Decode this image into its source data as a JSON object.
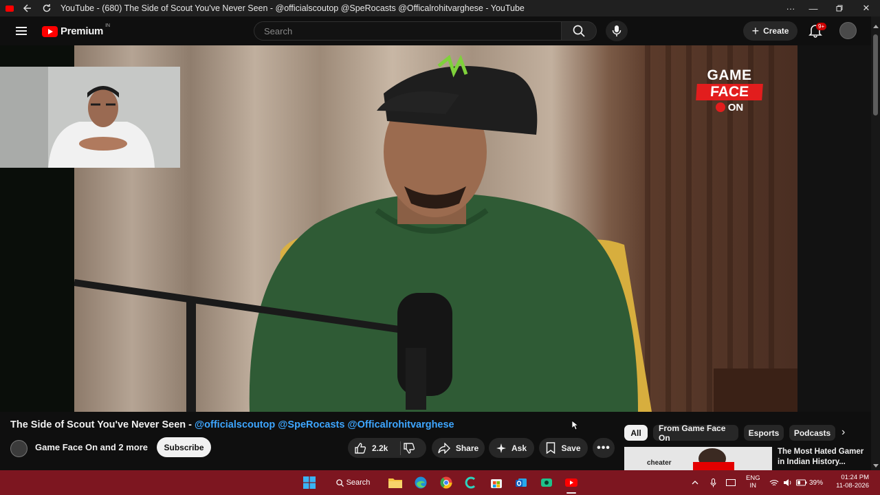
{
  "window": {
    "title": "YouTube - (680) The Side of Scout You've Never Seen - @officialscoutop @SpeRocasts @Officalrohitvarghese - YouTube"
  },
  "masthead": {
    "logo_text": "Premium",
    "country_code": "IN",
    "search_placeholder": "Search",
    "create_label": "Create",
    "notification_count": "9+"
  },
  "video": {
    "overlay_line1": "GAME",
    "overlay_line2": "FACE",
    "overlay_line3": "ON"
  },
  "details": {
    "title_prefix": "The Side of Scout You've Never Seen - ",
    "title_mentions": "@officialscoutop @SpeRocasts @Officalrohitvarghese",
    "channel": "Game Face On and 2 more",
    "subscribe_label": "Subscribe",
    "like_count": "2.2k",
    "share_label": "Share",
    "ask_label": "Ask",
    "save_label": "Save"
  },
  "chips": [
    "All",
    "From Game Face On",
    "Esports",
    "Podcasts"
  ],
  "related": {
    "thumb_text": "cheater",
    "title": "The Most Hated Gamer in Indian History..."
  },
  "taskbar": {
    "search_label": "Search",
    "lang_line1": "ENG",
    "lang_line2": "IN",
    "battery": "39%",
    "time": "01:24 PM",
    "date": "11-08-2026"
  },
  "colors": {
    "accent_red": "#ff0000",
    "link_blue": "#3ea6ff",
    "taskbar": "#7d1620"
  }
}
